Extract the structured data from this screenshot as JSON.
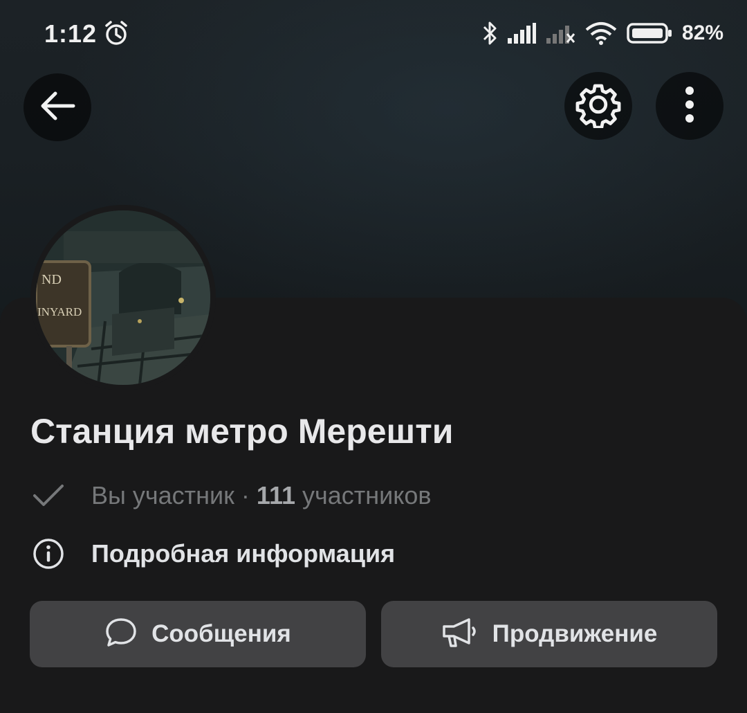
{
  "status_bar": {
    "time": "1:12",
    "battery_percent": "82%",
    "icons": [
      "alarm-icon",
      "bluetooth-icon",
      "signal-icon",
      "signal-no-service-icon",
      "wifi-icon",
      "battery-icon"
    ]
  },
  "header": {
    "back_icon": "arrow-left-icon",
    "settings_icon": "gear-icon",
    "more_icon": "more-vertical-icon"
  },
  "avatar": {
    "sign_lines": [
      "ND",
      "INYARD"
    ]
  },
  "group": {
    "title": "Станция метро Мерешти",
    "member_status": "Вы участник",
    "separator": " · ",
    "member_count": "111",
    "member_count_suffix": " участников",
    "info_link": "Подробная информация"
  },
  "actions": {
    "messages_label": "Сообщения",
    "promotion_label": "Продвижение"
  },
  "colors": {
    "background": "#19191a",
    "button": "#424244",
    "primary_text": "#e1e3e6",
    "secondary_text": "#76787a"
  }
}
